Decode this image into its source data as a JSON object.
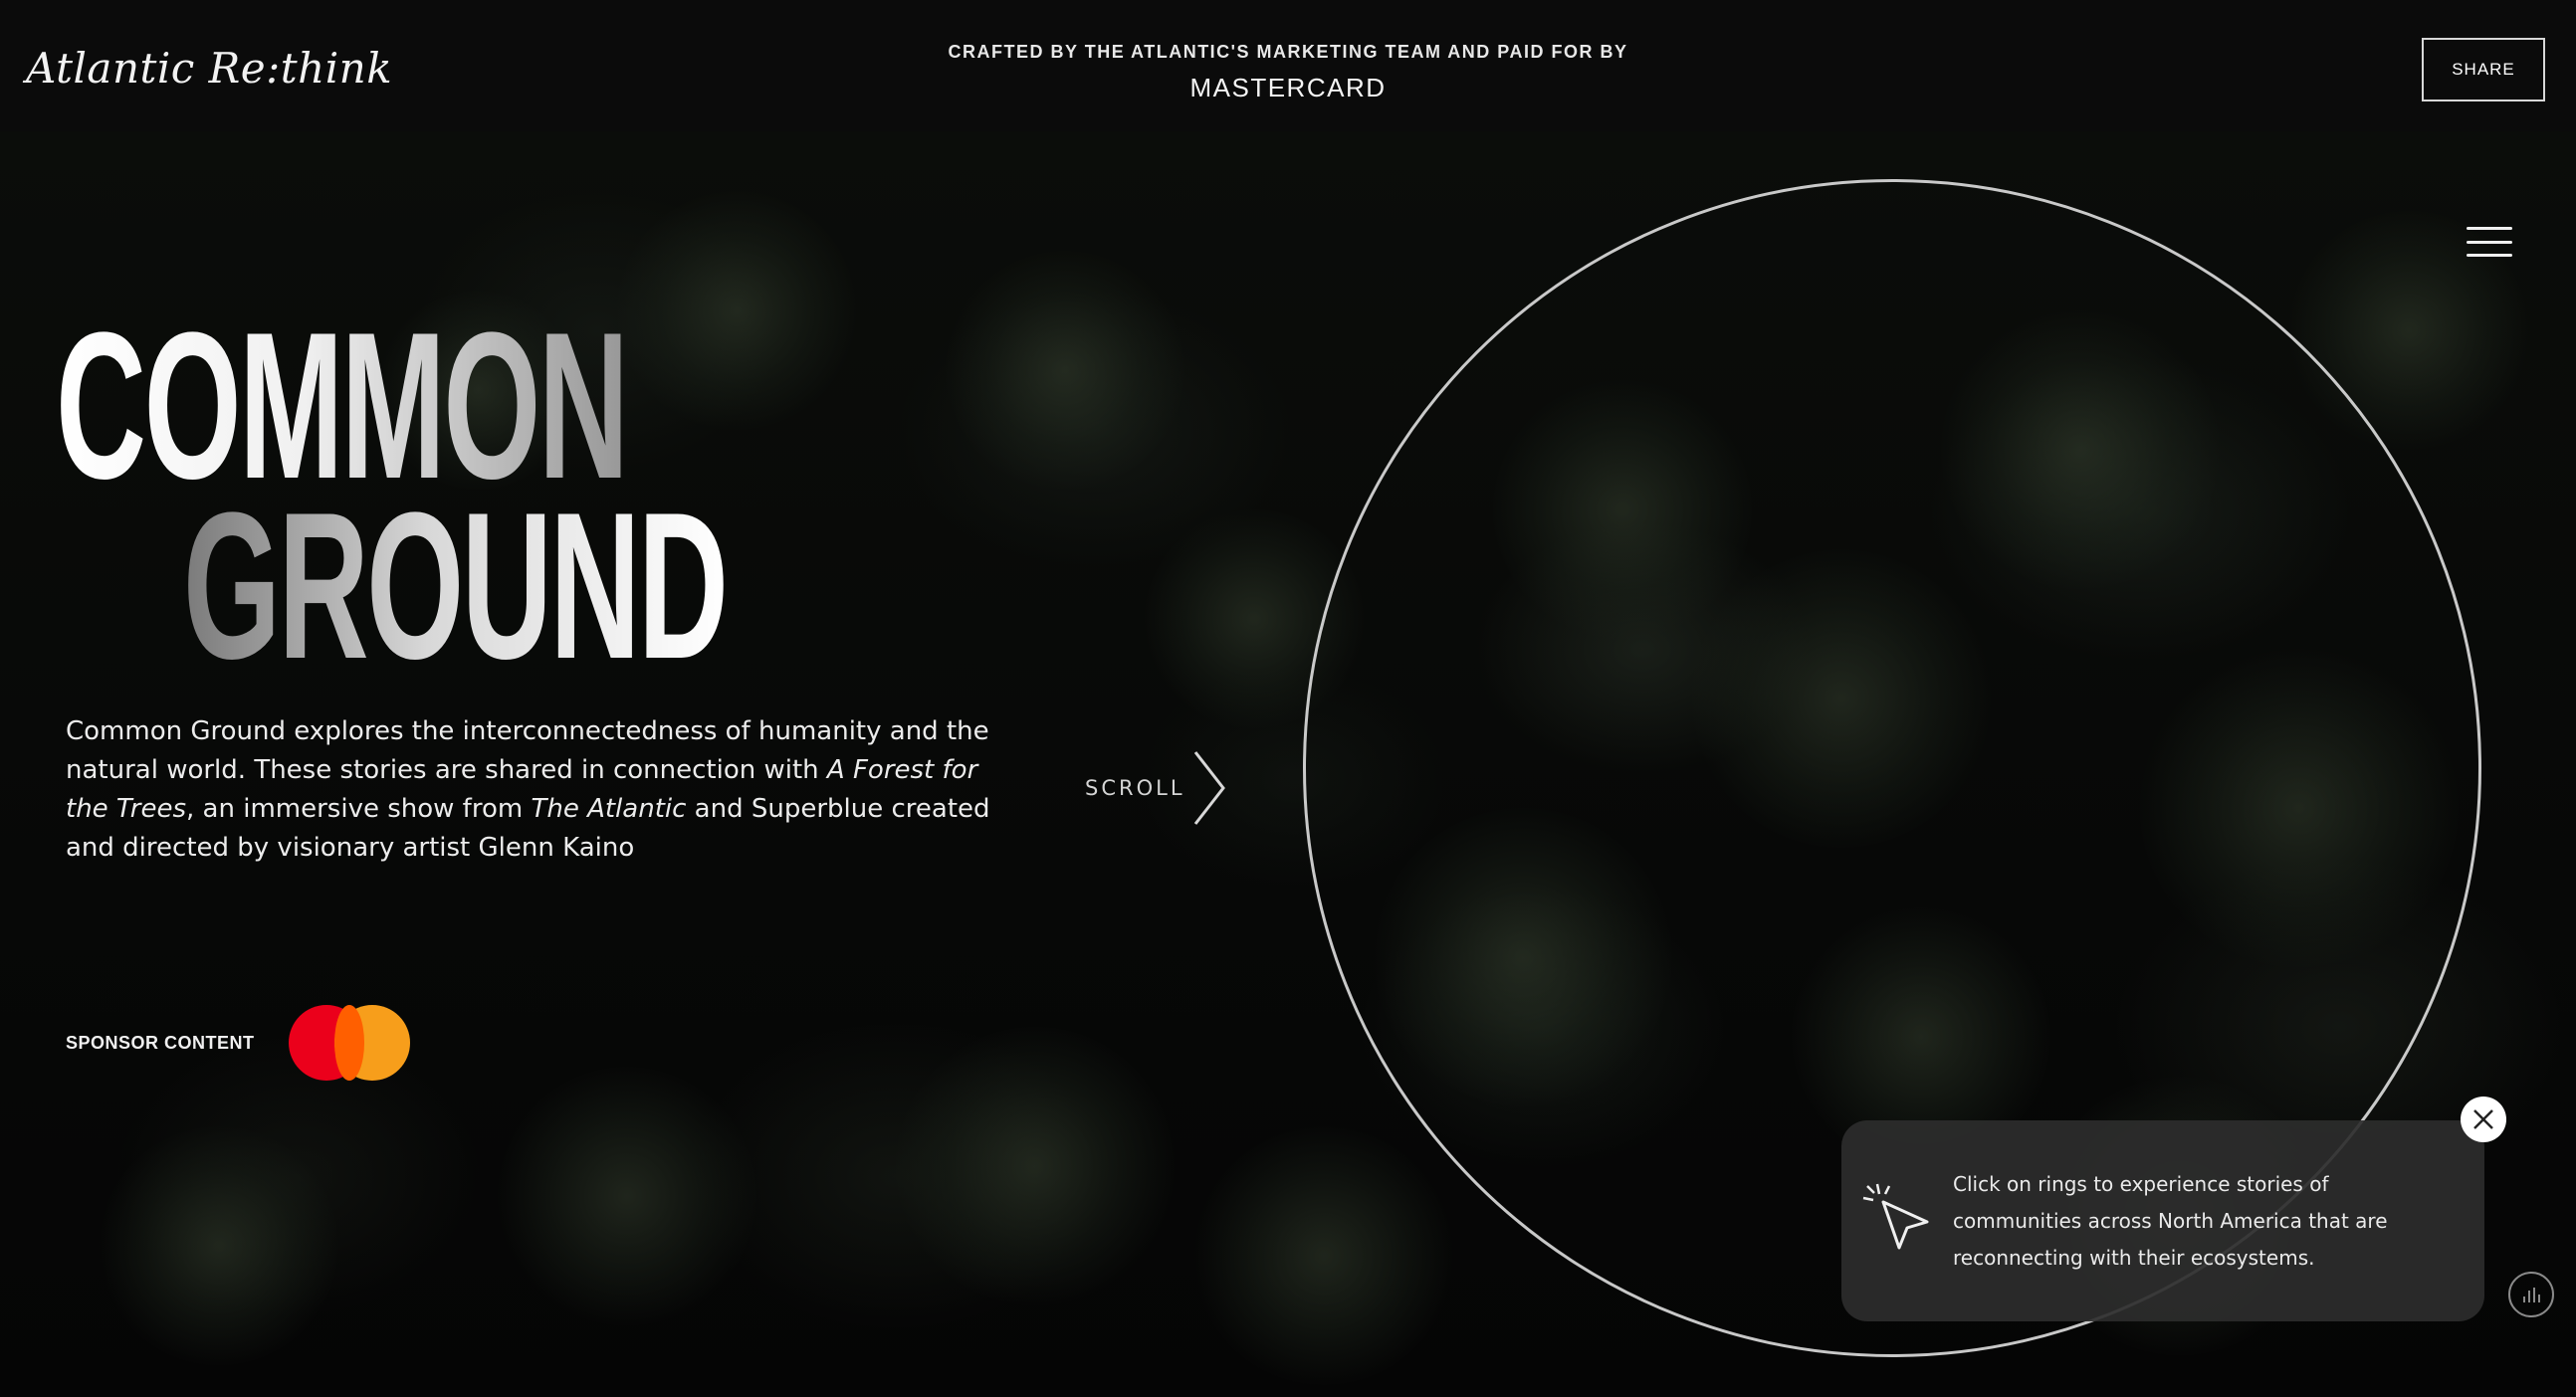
{
  "header": {
    "brand": "Atlantic Re:think",
    "sponsor_small": "CRAFTED BY THE ATLANTIC'S MARKETING TEAM AND PAID FOR BY",
    "sponsor_big": "MASTERCARD",
    "share_label": "SHARE"
  },
  "hero": {
    "title_line1": "COMMON",
    "title_line2": "GROUND",
    "description": {
      "part1": "Common Ground explores the interconnectedness of humanity and the natural world. These stories are shared in connection with ",
      "italic1": "A Forest for the Trees",
      "part2": ", an immersive show from ",
      "italic2": "The Atlantic",
      "part3": " and Superblue created and directed by visionary artist Glenn Kaino"
    },
    "sponsor_label": "SPONSOR CONTENT",
    "sponsor_logo": "mastercard-logo",
    "scroll_label": "SCROLL"
  },
  "tooltip": {
    "text": "Click on rings to experience stories of communities across North America that are reconnecting with their ecosystems.",
    "icon": "cursor-click-icon"
  },
  "icons": {
    "menu": "hamburger-menu-icon",
    "close": "close-icon",
    "audio": "audio-bars-icon",
    "scroll": "chevron-right-icon"
  },
  "colors": {
    "background": "#050505",
    "header_bg": "#0b0b0b",
    "mastercard_red": "#eb001b",
    "mastercard_orange": "#f79e1b",
    "tooltip_bg": "#2c2c2c"
  }
}
